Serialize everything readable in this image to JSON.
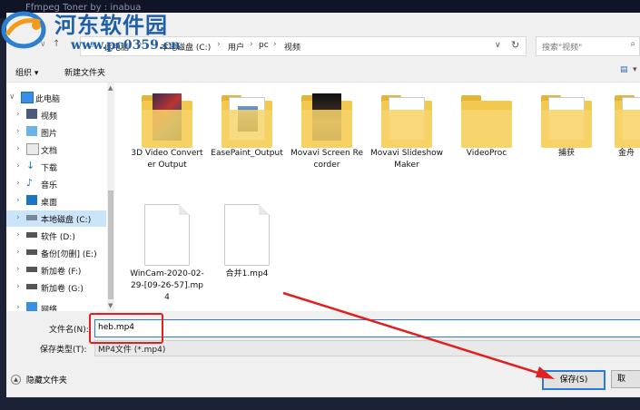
{
  "window": {
    "title": "Ffmpeg Toner  by : inabua"
  },
  "watermark": {
    "name": "河东软件园",
    "url": "www.pc0359.cn"
  },
  "address": {
    "crumbs": [
      "此电脑",
      "本地磁盘 (C:)",
      "用户",
      "pc",
      "视频"
    ],
    "search_placeholder": "搜索\"视频\""
  },
  "toolbar": {
    "organize": "组织 ▾",
    "new_folder": "新建文件夹"
  },
  "nav": {
    "items": [
      {
        "label": "此电脑",
        "icon": "pc-icon"
      },
      {
        "label": "视频",
        "icon": "video-folder-icon"
      },
      {
        "label": "图片",
        "icon": "pictures-folder-icon"
      },
      {
        "label": "文档",
        "icon": "documents-folder-icon"
      },
      {
        "label": "下载",
        "icon": "download-icon"
      },
      {
        "label": "音乐",
        "icon": "music-icon"
      },
      {
        "label": "桌面",
        "icon": "desktop-icon"
      },
      {
        "label": "本地磁盘 (C:)",
        "icon": "drive-icon"
      },
      {
        "label": "软件 (D:)",
        "icon": "drive-icon"
      },
      {
        "label": "备份[勿删] (E:)",
        "icon": "drive-icon"
      },
      {
        "label": "新加卷 (F:)",
        "icon": "drive-icon"
      },
      {
        "label": "新加卷 (G:)",
        "icon": "drive-icon"
      },
      {
        "label": "网络",
        "icon": "network-icon"
      }
    ]
  },
  "files": [
    {
      "label": "3D Video Converter Output",
      "kind": "folder"
    },
    {
      "label": "EasePaint_Output",
      "kind": "folder"
    },
    {
      "label": "Movavi Screen Recorder",
      "kind": "folder"
    },
    {
      "label": "Movavi Slideshow Maker",
      "kind": "folder"
    },
    {
      "label": "VideoProc",
      "kind": "folder"
    },
    {
      "label": "捕获",
      "kind": "folder"
    },
    {
      "label": "金舟",
      "kind": "folder"
    },
    {
      "label": "WinCam-2020-02-29-[09-26-57].mp4",
      "kind": "file"
    },
    {
      "label": "合并1.mp4",
      "kind": "file"
    }
  ],
  "form": {
    "filename_label": "文件名(N):",
    "filename_value": "heb.mp4",
    "type_label": "保存类型(T):",
    "type_value": "MP4文件 (*.mp4)"
  },
  "footer": {
    "hide_folders": "隐藏文件夹",
    "save": "保存(S)",
    "cancel": "取"
  },
  "colors": {
    "accent": "#2a7bd3",
    "highlight": "#e02020",
    "folder": "#f2c94c"
  }
}
